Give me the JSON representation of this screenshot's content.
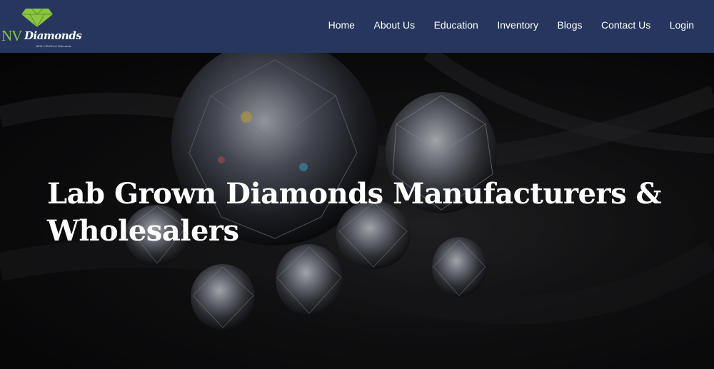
{
  "brand": {
    "logo_mark": "NV",
    "logo_word": "Diamonds",
    "tagline": "NEW VISION of Diamonds",
    "icon": "diamond-icon",
    "colors": {
      "nav_bg": "#26365e",
      "accent": "#8bc63f",
      "text": "#ffffff"
    }
  },
  "nav": {
    "items": [
      {
        "label": "Home"
      },
      {
        "label": "About Us"
      },
      {
        "label": "Education"
      },
      {
        "label": "Inventory"
      },
      {
        "label": "Blogs"
      },
      {
        "label": "Contact Us"
      },
      {
        "label": "Login"
      }
    ]
  },
  "hero": {
    "title": "Lab Grown Diamonds Manufacturers & Wholesalers"
  }
}
